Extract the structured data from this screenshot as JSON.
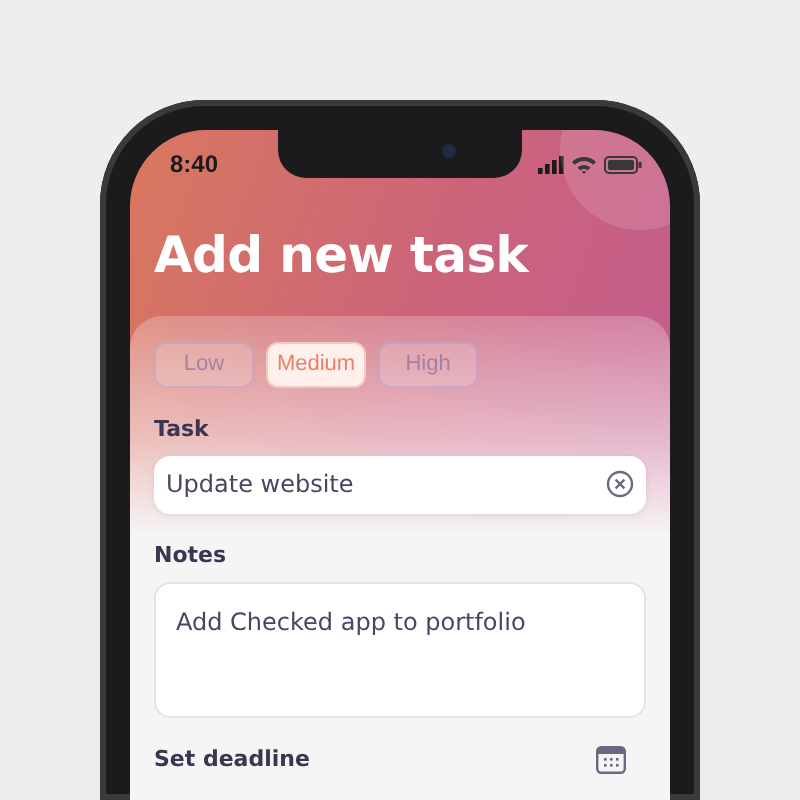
{
  "status_bar": {
    "time": "8:40"
  },
  "title": "Add new task",
  "priorities": [
    {
      "label": "Low",
      "selected": false
    },
    {
      "label": "Medium",
      "selected": true
    },
    {
      "label": "High",
      "selected": false
    }
  ],
  "task": {
    "label": "Task",
    "value": "Update website"
  },
  "notes": {
    "label": "Notes",
    "value": "Add Checked app to portfolio"
  },
  "deadline": {
    "label": "Set deadline"
  }
}
